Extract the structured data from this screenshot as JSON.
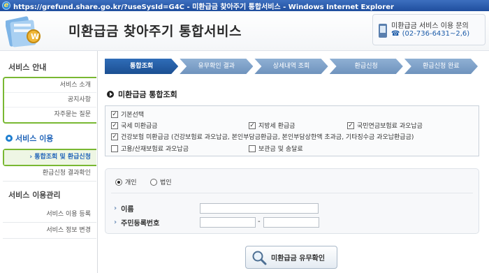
{
  "browser": {
    "title": "https://grefund.share.go.kr/?useSysId=G4C - 미환급금 찾아주기 통합서비스 - Windows Internet Explorer"
  },
  "header": {
    "site_title": "미환급금 찾아주기 통합서비스",
    "contact_title": "미환급금 서비스 이용 문의",
    "contact_phone": "☎ (02-736-6431~2,6)"
  },
  "leftnav": {
    "section1": "서비스 안내",
    "section1_items": [
      "서비스 소개",
      "공지사항",
      "자주묻는 질문"
    ],
    "section2": "서비스 이용",
    "section2_items": [
      "통합조회 및 환급신청",
      "환급신청 결과확인"
    ],
    "section3": "서비스 이용관리",
    "section3_items": [
      "서비스 이용 등록",
      "서비스 정보 변경"
    ]
  },
  "steps": [
    "통합조회",
    "유무확인 결과",
    "상세내역 조회",
    "환급신청",
    "환급신청 완료"
  ],
  "section_title": "미환급금 통합조회",
  "checkboxes": {
    "basic": "기본선택",
    "national_tax": "국세 미환급금",
    "local_tax": "지방세 환급금",
    "pension": "국민연금보험료 과오납금",
    "health": "건강보험 미환급금 (건강보험료 과오납금, 본인부담금환급금, 본인부담상한액 초과금, 기타징수금 과오납환급금)",
    "employment": "고용/산재보험료 과오납금",
    "deposit": "보관금 및 송달료"
  },
  "form": {
    "radio_personal": "개인",
    "radio_corporate": "법인",
    "name_label": "이름",
    "id_label": "주민등록번호",
    "dash": "-"
  },
  "confirm_button": "미환급금 유무확인",
  "colors": {
    "accent": "#1f63b8",
    "nav_border": "#79b832",
    "step_active": "#2f6db8",
    "step_inactive": "#8fb0d4"
  }
}
